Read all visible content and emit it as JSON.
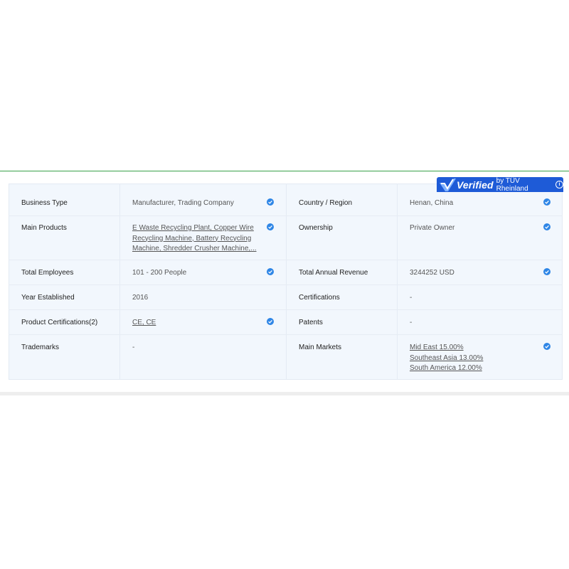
{
  "badge": {
    "verified": "Verified",
    "by": "by TÜV Rheinland",
    "info": "i"
  },
  "rows": [
    {
      "left_label": "Business Type",
      "left_value": "Manufacturer, Trading Company",
      "right_label": "Country / Region",
      "right_value": "Henan, China"
    },
    {
      "left_label": "Main Products",
      "left_value_lines": [
        "E Waste Recycling Plant, Copper Wire",
        "Recycling Machine, Battery Recycling",
        "Machine, Shredder Crusher Machine,..."
      ],
      "right_label": "Ownership",
      "right_value": "Private Owner"
    },
    {
      "left_label": "Total Employees",
      "left_value": "101 - 200 People",
      "right_label": "Total Annual Revenue",
      "right_value": "3244252 USD"
    },
    {
      "left_label": "Year Established",
      "left_value": "2016",
      "right_label": "Certifications",
      "right_value": "-"
    },
    {
      "left_label": "Product Certifications(2)",
      "left_value": "CE, CE",
      "right_label": "Patents",
      "right_value": "-"
    },
    {
      "left_label": "Trademarks",
      "left_value": "-",
      "right_label": "Main Markets",
      "right_value_lines": [
        "Mid East 15.00%",
        "Southeast Asia 13.00%",
        "South America 12.00%"
      ]
    }
  ],
  "colors": {
    "accent_green": "#3aa14a",
    "badge_blue": "#1e5bd7",
    "check_blue": "#2f86e6",
    "card_bg": "#f2f7fd"
  },
  "icons": {
    "verified_check": "verified-check-icon"
  }
}
